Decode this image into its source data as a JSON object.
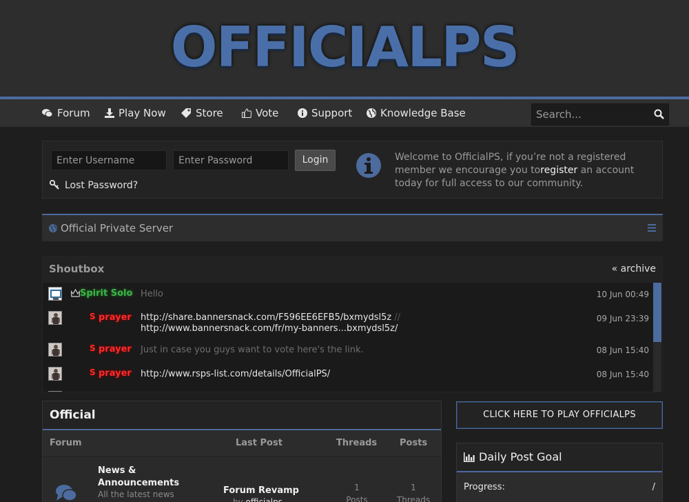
{
  "site": {
    "logo_text": "OFFICIALPS"
  },
  "nav": {
    "items": [
      {
        "label": "Forum",
        "icon": "comments-icon"
      },
      {
        "label": "Play Now",
        "icon": "download-icon"
      },
      {
        "label": "Store",
        "icon": "tag-icon"
      },
      {
        "label": "Vote",
        "icon": "thumbs-up-icon"
      },
      {
        "label": "Support",
        "icon": "info-circle-icon"
      },
      {
        "label": "Knowledge Base",
        "icon": "globe-icon"
      }
    ],
    "search_placeholder": "Search..."
  },
  "login": {
    "username_placeholder": "Enter Username",
    "password_placeholder": "Enter Password",
    "login_label": "Login",
    "lost_password": "Lost Password?",
    "welcome_before": "Welcome to OfficialPS, if you’re not a registered member we encourage you to",
    "welcome_link": "register",
    "welcome_after": " an account today for full access to our community."
  },
  "server_bar": {
    "title": "Official Private Server"
  },
  "shoutbox": {
    "title": "Shoutbox",
    "archive": "« archive",
    "rows": [
      {
        "user": "Spirit Solo",
        "message": "Hello",
        "time": "10 Jun 00:49"
      },
      {
        "user": "prayer",
        "message": "http://share.bannersnack.com/F596EE6EFB5/bxmydsl5z",
        "sep": "//",
        "message2": "http://www.bannersnack.com/fr/my-banners...bxmydsl5z/",
        "time": "09 Jun 23:39"
      },
      {
        "user": "prayer",
        "message": "Just in case you guys want to vote  here's the link.",
        "time": "08 Jun 15:40"
      },
      {
        "user": "prayer",
        "message": "http://www.rsps-list.com/details/OfficialPS/",
        "time": "08 Jun 15:40"
      }
    ]
  },
  "forum": {
    "title": "Official",
    "headers": {
      "forum": "Forum",
      "last_post": "Last Post",
      "threads": "Threads",
      "posts": "Posts"
    },
    "rows": [
      {
        "name_line1": "News &",
        "name_line2": "Announcements",
        "description": "All the latest news",
        "last_post_title": "Forum Revamp",
        "last_post_by_prefix": "by",
        "last_post_by_user": "officialps",
        "threads_num": "1",
        "threads_label": "Posts",
        "posts_num": "1",
        "posts_label": "Threads"
      }
    ]
  },
  "play_button": {
    "label": "CLICK HERE TO PLAY OFFICIALPS"
  },
  "daily_goal": {
    "title": "Daily Post Goal",
    "progress_label": "Progress:",
    "progress_value": "/"
  },
  "colors": {
    "accent": "#4c6b9e",
    "username_green": "#3cb34a",
    "username_red": "#ff2a2a"
  }
}
